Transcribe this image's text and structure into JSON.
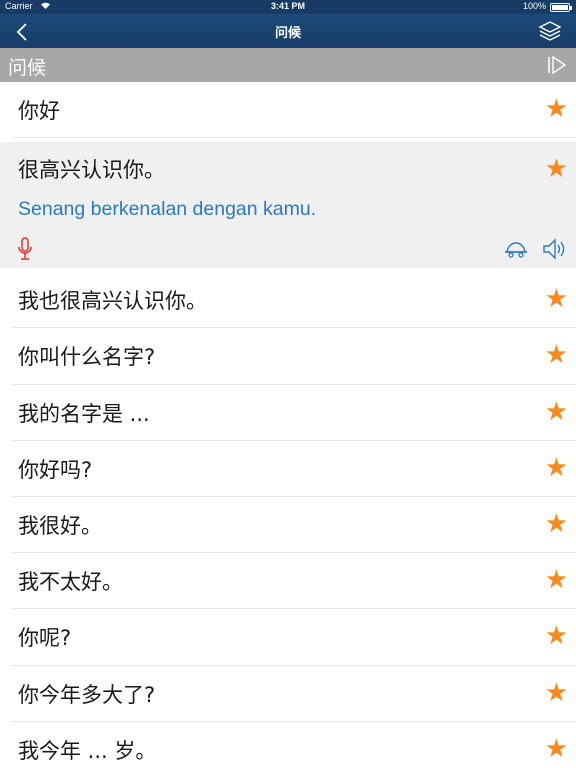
{
  "status_bar": {
    "carrier": "Carrier",
    "time": "3:41 PM",
    "battery": "100%"
  },
  "nav": {
    "title": "问候",
    "back_icon": "chevron-left-icon",
    "layers_icon": "layers-icon"
  },
  "section": {
    "title": "问候",
    "play_icon": "play-all-icon"
  },
  "colors": {
    "nav_bg": "#1d4a7a",
    "section_bg": "#a7a7a7",
    "star": "#f68a1f",
    "translation": "#2b79c2",
    "mic": "#d9342b"
  },
  "phrases": [
    {
      "text": "你好",
      "favorite": true
    },
    {
      "text": "很高兴认识你。",
      "translation": "Senang berkenalan dengan kamu.",
      "favorite": true,
      "expanded": true
    },
    {
      "text": "我也很高兴认识你。",
      "favorite": true
    },
    {
      "text": "你叫什么名字?",
      "favorite": true
    },
    {
      "text": "我的名字是 ...",
      "favorite": true
    },
    {
      "text": "你好吗?",
      "favorite": true
    },
    {
      "text": "我很好。",
      "favorite": true
    },
    {
      "text": "我不太好。",
      "favorite": true
    },
    {
      "text": "你呢?",
      "favorite": true
    },
    {
      "text": "你今年多大了?",
      "favorite": true
    },
    {
      "text": "我今年 ... 岁。",
      "favorite": true
    }
  ],
  "star_glyph": "★"
}
